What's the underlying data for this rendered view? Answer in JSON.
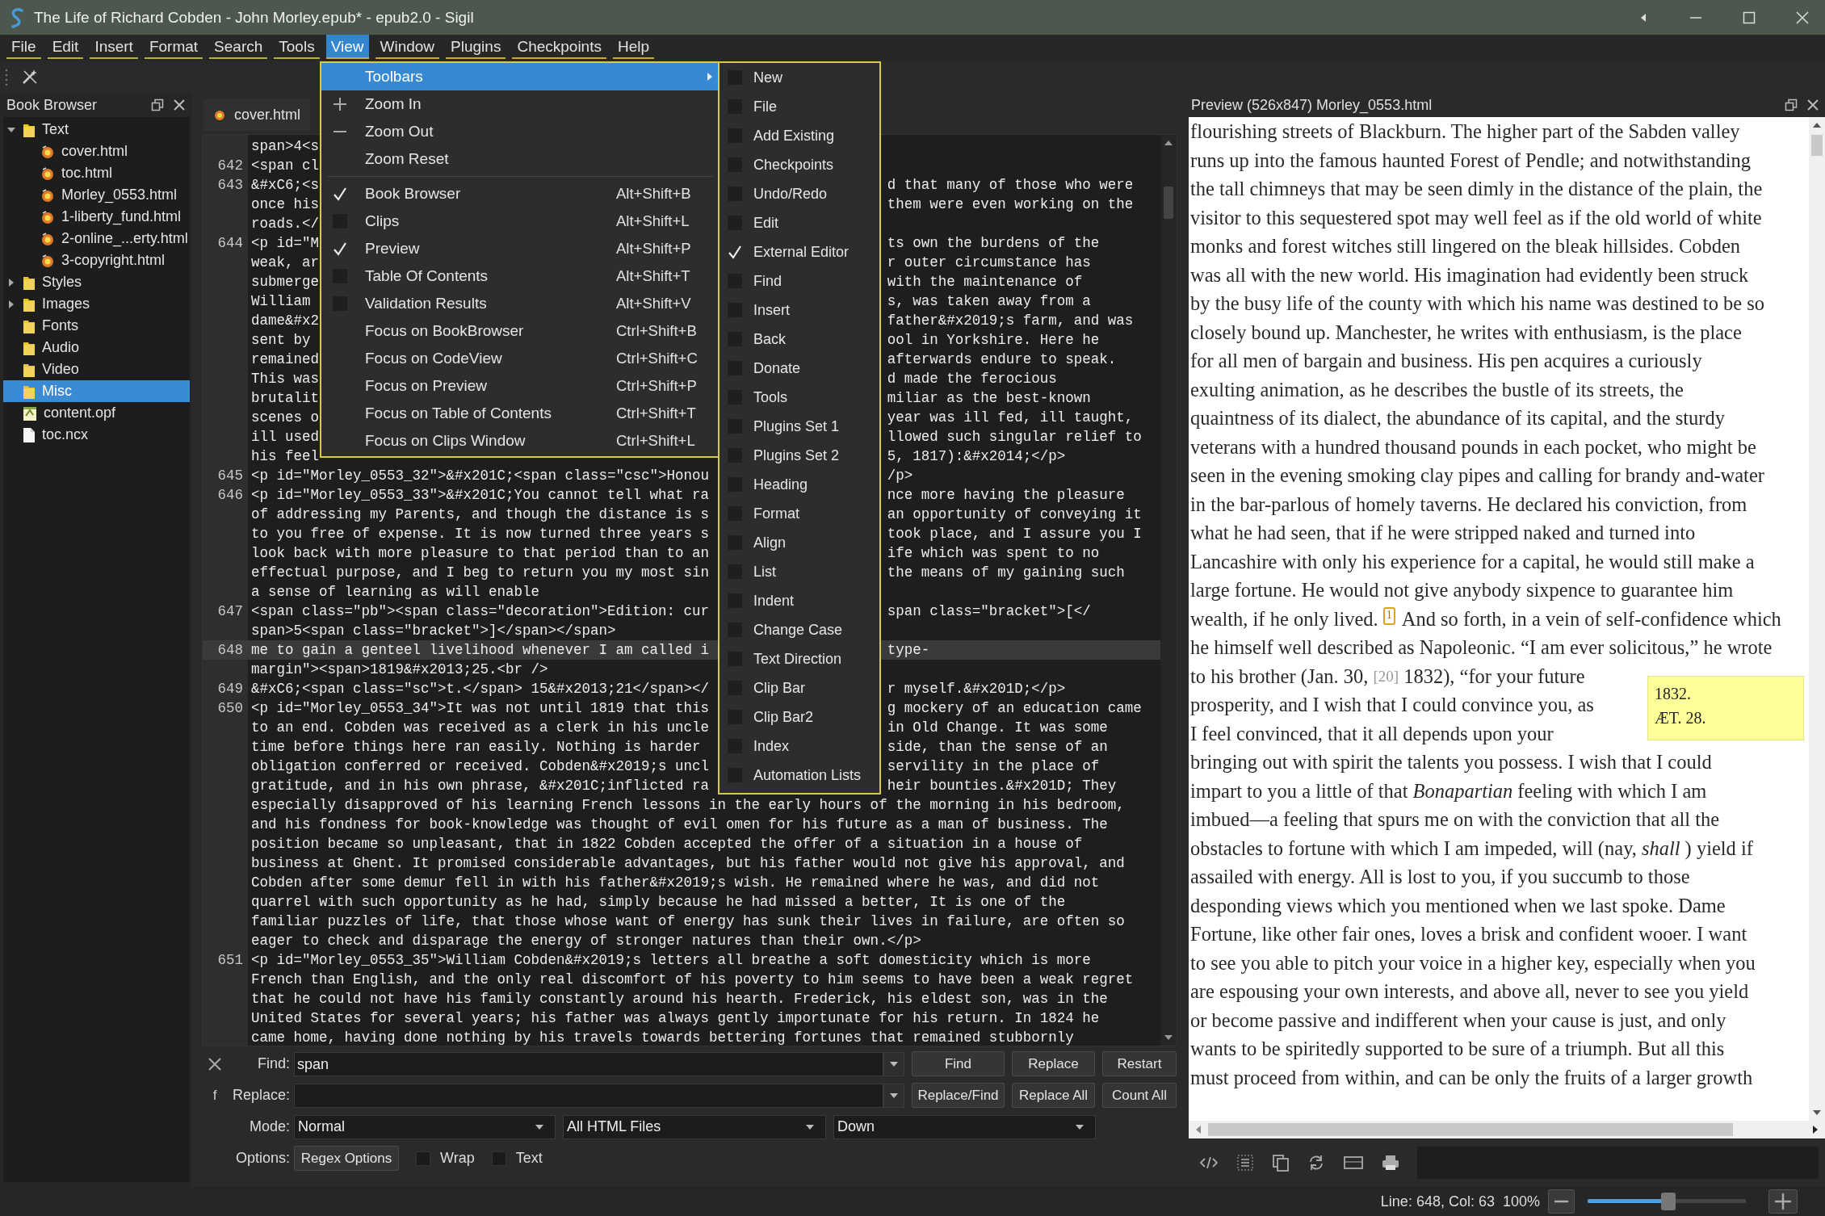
{
  "window": {
    "title": "The Life of Richard Cobden - John Morley.epub* - epub2.0 - Sigil"
  },
  "menu_bar": [
    {
      "label": "File",
      "selected": false
    },
    {
      "label": "Edit",
      "selected": false
    },
    {
      "label": "Insert",
      "selected": false
    },
    {
      "label": "Format",
      "selected": false
    },
    {
      "label": "Search",
      "selected": false
    },
    {
      "label": "Tools",
      "selected": false
    },
    {
      "label": "View",
      "selected": true
    },
    {
      "label": "Window",
      "selected": false
    },
    {
      "label": "Plugins",
      "selected": false
    },
    {
      "label": "Checkpoints",
      "selected": false
    },
    {
      "label": "Help",
      "selected": false
    }
  ],
  "view_menu": {
    "items": [
      {
        "kind": "submenu",
        "label": "Toolbars",
        "selected": true
      },
      {
        "kind": "zoom-in",
        "label": "Zoom In",
        "selected": false
      },
      {
        "kind": "zoom-out",
        "label": "Zoom Out",
        "selected": false
      },
      {
        "kind": "plain",
        "label": "Zoom Reset",
        "selected": false
      },
      {
        "kind": "separator"
      },
      {
        "kind": "check",
        "label": "Book Browser",
        "shortcut": "Alt+Shift+B",
        "checked": true,
        "selected": false
      },
      {
        "kind": "check",
        "label": "Clips",
        "shortcut": "Alt+Shift+L",
        "checked": false,
        "selected": false
      },
      {
        "kind": "check",
        "label": "Preview",
        "shortcut": "Alt+Shift+P",
        "checked": true,
        "selected": false
      },
      {
        "kind": "check",
        "label": "Table Of Contents",
        "shortcut": "Alt+Shift+T",
        "checked": false,
        "selected": false
      },
      {
        "kind": "check",
        "label": "Validation Results",
        "shortcut": "Alt+Shift+V",
        "checked": false,
        "selected": false
      },
      {
        "kind": "plain",
        "label": "Focus on BookBrowser",
        "shortcut": "Ctrl+Shift+B",
        "selected": false
      },
      {
        "kind": "plain",
        "label": "Focus on CodeView",
        "shortcut": "Ctrl+Shift+C",
        "selected": false
      },
      {
        "kind": "plain",
        "label": "Focus on Preview",
        "shortcut": "Ctrl+Shift+P",
        "selected": false
      },
      {
        "kind": "plain",
        "label": "Focus on Table of Contents",
        "shortcut": "Ctrl+Shift+T",
        "selected": false
      },
      {
        "kind": "plain",
        "label": "Focus on Clips Window",
        "shortcut": "Ctrl+Shift+L",
        "selected": false
      }
    ]
  },
  "toolbars_submenu": {
    "items": [
      {
        "label": "New",
        "checked": false
      },
      {
        "label": "File",
        "checked": false
      },
      {
        "label": "Add Existing",
        "checked": false
      },
      {
        "label": "Checkpoints",
        "checked": false
      },
      {
        "label": "Undo/Redo",
        "checked": false
      },
      {
        "label": "Edit",
        "checked": false
      },
      {
        "label": "External Editor",
        "checked": true
      },
      {
        "label": "Find",
        "checked": false
      },
      {
        "label": "Insert",
        "checked": false
      },
      {
        "label": "Back",
        "checked": false
      },
      {
        "label": "Donate",
        "checked": false
      },
      {
        "label": "Tools",
        "checked": false
      },
      {
        "label": "Plugins Set 1",
        "checked": false
      },
      {
        "label": "Plugins Set 2",
        "checked": false
      },
      {
        "label": "Heading",
        "checked": false
      },
      {
        "label": "Format",
        "checked": false
      },
      {
        "label": "Align",
        "checked": false
      },
      {
        "label": "List",
        "checked": false
      },
      {
        "label": "Indent",
        "checked": false
      },
      {
        "label": "Change Case",
        "checked": false
      },
      {
        "label": "Text Direction",
        "checked": false
      },
      {
        "label": "Clip Bar",
        "checked": false
      },
      {
        "label": "Clip Bar2",
        "checked": false
      },
      {
        "label": "Index",
        "checked": false
      },
      {
        "label": "Automation Lists",
        "checked": false
      }
    ]
  },
  "book_browser": {
    "title": "Book Browser",
    "tree": [
      {
        "label": "Text",
        "kind": "folder",
        "expanded": true,
        "selected": false,
        "children": [
          {
            "label": "cover.html",
            "kind": "html",
            "selected": false
          },
          {
            "label": "toc.html",
            "kind": "html",
            "selected": false
          },
          {
            "label": "Morley_0553.html",
            "kind": "html",
            "selected": false
          },
          {
            "label": "1-liberty_fund.html",
            "kind": "html",
            "selected": false
          },
          {
            "label": "2-online_...erty.html",
            "kind": "html",
            "selected": false
          },
          {
            "label": "3-copyright.html",
            "kind": "html",
            "selected": false
          }
        ]
      },
      {
        "label": "Styles",
        "kind": "folder",
        "expanded": false,
        "selected": false
      },
      {
        "label": "Images",
        "kind": "folder",
        "expanded": false,
        "selected": false
      },
      {
        "label": "Fonts",
        "kind": "folder",
        "selected": false
      },
      {
        "label": "Audio",
        "kind": "folder",
        "selected": false
      },
      {
        "label": "Video",
        "kind": "folder",
        "selected": false
      },
      {
        "label": "Misc",
        "kind": "folder",
        "selected": true
      },
      {
        "label": "content.opf",
        "kind": "opf",
        "selected": false
      },
      {
        "label": "toc.ncx",
        "kind": "file",
        "selected": false
      }
    ]
  },
  "editor": {
    "tabs": [
      {
        "label": "cover.html",
        "selected": true
      }
    ],
    "lines": [
      {
        "left": "span>4<s",
        "current": false
      },
      {
        "num": "642",
        "left": "<span cl",
        "current": false
      },
      {
        "num": "643",
        "left": "&#xC6;<s",
        "right": "d that many of those who were",
        "current": false
      },
      {
        "left": "once his",
        "right": "them were even working on the",
        "current": false
      },
      {
        "left": "roads.</",
        "current": false
      },
      {
        "num": "644",
        "left": "<p id=\"M",
        "right": "ts own the burdens of the",
        "current": false
      },
      {
        "left": "weak, ar",
        "right": "r outer circumstance has",
        "current": false
      },
      {
        "left": "submerge",
        "right": "with the maintenance of",
        "current": false
      },
      {
        "left": "William",
        "right": "s, was taken away from a",
        "current": false
      },
      {
        "left": "dame&#x2",
        "right": "father&#x2019;s farm, and was",
        "current": false
      },
      {
        "left": "sent by",
        "right": "ool in Yorkshire. Here he",
        "current": false
      },
      {
        "left": "remained",
        "right": "afterwards endure to speak.",
        "current": false
      },
      {
        "left": "This was",
        "right": "d made the ferocious",
        "current": false
      },
      {
        "left": "brutalit",
        "right": "miliar as the best-known",
        "current": false
      },
      {
        "left": "scenes o",
        "right": "year was ill fed, ill taught,",
        "current": false
      },
      {
        "left": "ill used",
        "right": "llowed such singular relief to",
        "current": false
      },
      {
        "left": "his feel",
        "right": "5, 1817):&#x2014;</p>",
        "current": false
      },
      {
        "num": "645",
        "left": "<p id=\"Morley_0553_32\">&#x201C;<span class=\"csc\">Honou",
        "right": "/p>",
        "current": false
      },
      {
        "num": "646",
        "left": "<p id=\"Morley_0553_33\">&#x201C;You cannot tell what ra",
        "right": "nce more having the pleasure",
        "current": false
      },
      {
        "left": "of addressing my Parents, and though the distance is s",
        "right": "an opportunity of conveying it",
        "current": false
      },
      {
        "left": "to you free of expense. It is now turned three years s",
        "right": "took place, and I assure you I",
        "current": false
      },
      {
        "left": "look back with more pleasure to that period than to an",
        "right": "ife which was spent to no",
        "current": false
      },
      {
        "left": "effectual purpose, and I beg to return you my most sin",
        "right": "the means of my gaining such",
        "current": false
      },
      {
        "left": "a sense of learning as will enable",
        "current": false
      },
      {
        "num": "647",
        "left": "<span class=\"pb\"><span class=\"decoration\">Edition: cur",
        "right": "span class=\"bracket\">[</",
        "current": false
      },
      {
        "left": "span>5<span class=\"bracket\">]</span></span>",
        "current": false
      },
      {
        "num": "648",
        "left": "me to gain a genteel livelihood whenever I am called i",
        "right": "type-",
        "current": true
      },
      {
        "left": "margin\"><span>1819&#x2013;25.<br />",
        "current": false
      },
      {
        "num": "649",
        "left": "&#xC6;<span class=\"sc\">t.</span> 15&#x2013;21</span></",
        "right": "r myself.&#x201D;</p>",
        "current": false
      },
      {
        "num": "650",
        "left": "<p id=\"Morley_0553_34\">It was not until 1819 that this",
        "right": "g mockery of an education came",
        "current": false
      },
      {
        "left": "to an end. Cobden was received as a clerk in his uncle",
        "right": "in Old Change. It was some",
        "current": false
      },
      {
        "left": "time before things here ran easily. Nothing is harder",
        "right": "side, than the sense of an",
        "current": false
      },
      {
        "left": "obligation conferred or received. Cobden&#x2019;s uncl",
        "right": "servility in the place of",
        "current": false
      },
      {
        "left": "gratitude, and in his own phrase, &#x201C;inflicted ra",
        "right": "heir bounties.&#x201D; They",
        "current": false
      },
      {
        "text": "especially disapproved of his learning French lessons in the early hours of the morning in his bedroom,",
        "current": false
      },
      {
        "text": "and his fondness for book-knowledge was thought of evil omen for his future as a man of business. The",
        "current": false
      },
      {
        "text": "position became so unpleasant, that in 1822 Cobden accepted the offer of a situation in a house of",
        "current": false
      },
      {
        "text": "business at Ghent. It promised considerable advantages, but his father would not give his approval, and",
        "current": false
      },
      {
        "text": "Cobden after some demur fell in with his father&#x2019;s wish. He remained where he was, and did not",
        "current": false
      },
      {
        "text": "quarrel with such opportunity as he had, simply because he had missed a better, It is one of the",
        "current": false
      },
      {
        "text": "familiar puzzles of life, that those whose want of energy has sunk their lives in failure, are often so",
        "current": false
      },
      {
        "text": "eager to check and disparage the energy of stronger natures than their own.</p>",
        "current": false
      },
      {
        "num": "651",
        "text": "<p id=\"Morley_0553_35\">William Cobden&#x2019;s letters all breathe a soft domesticity which is more",
        "current": false
      },
      {
        "text": "French than English, and the only real discomfort of his poverty to him seems to have been a weak regret",
        "current": false
      },
      {
        "text": "that he could not have his family constantly around his hearth. Frederick, his eldest son, was in the",
        "current": false
      },
      {
        "text": "United States for several years; his father was always gently importunate for his return. In 1824 he",
        "current": false
      },
      {
        "text": "came home, having done nothing by his travels towards bettering fortunes that remained stubbornly",
        "current": false
      }
    ]
  },
  "find_bar": {
    "side_text": "f",
    "find_label": "Find:",
    "find_value": "span",
    "replace_label": "Replace:",
    "mode_label": "Mode:",
    "options_label": "Options:",
    "buttons": [
      [
        "Find",
        "Replace",
        "Restart"
      ],
      [
        "Replace/Find",
        "Replace All",
        "Count All"
      ]
    ],
    "dropdowns": [
      "Normal",
      "All HTML Files",
      "Down"
    ],
    "regex_button": "Regex Options",
    "checkboxes": [
      {
        "label": "Wrap",
        "checked": false
      },
      {
        "label": "Text",
        "checked": false
      }
    ]
  },
  "preview": {
    "title": "Preview (526x847) Morley_0553.html",
    "lines": [
      "flourishing streets of Blackburn. The higher part of the Sabden valley",
      "runs up into the famous haunted Forest of Pendle; and notwithstanding",
      "the tall chimneys that may be seen dimly in the distance of the plain, the",
      "visitor to this sequestered spot may well feel as if the old world of white",
      "monks and forest witches still lingered on the bleak hillsides. Cobden",
      "was all with the new world. His imagination had evidently been struck",
      "by the busy life of the county with which his name was destined to be so",
      "closely bound up. Manchester, he writes with enthusiasm, is the place",
      "for all men of bargain and business. His pen acquires a curiously",
      "exulting animation, as he describes the bustle of its streets, the",
      "quaintness of its dialect, the abundance of its capital, and the sturdy",
      "veterans with a hundred thousand pounds in each pocket, who might be",
      "seen in the evening smoking clay pipes and calling for brandy and-water",
      "in the bar-parlous of homely taverns. He declared his conviction, from",
      "what he had seen, that if he were stripped naked and turned into",
      "Lancashire with only his experience for a capital, he would still make a",
      "large fortune. He would not give anybody sixpence to guarantee him",
      {
        "parts": [
          {
            "kind": "text",
            "text": "wealth, if he only lived."
          },
          {
            "kind": "noteref",
            "text": "1"
          },
          {
            "kind": "text",
            "text": "And so forth, in a vein of self-confidence which"
          }
        ]
      },
      "he himself well described as Napoleonic. “I am ever solicitous,” he wrote",
      {
        "parts": [
          {
            "kind": "text",
            "text": "to his brother (Jan. 30,"
          },
          {
            "kind": "pagenum",
            "text": "[20]"
          },
          {
            "kind": "text",
            "text": "1832), “for your future"
          }
        ]
      },
      "prosperity, and I wish that I could convince you, as",
      "I feel convinced, that it all depends upon your",
      "bringing out with spirit the talents you possess. I wish that I could",
      "impart to you a little of that *Bonapartian* feeling with which I am",
      "imbued—a feeling that spurs me on with the conviction that all the",
      "obstacles to fortune with which I am impeded, will (nay, *shall*) yield if",
      "assailed with energy. All is lost to you, if you succumb to those",
      "desponding views which you mentioned when we last spoke. Dame",
      "Fortune, like other fair ones, loves a brisk and confident wooer. I want",
      "to see you able to pitch your voice in a higher key, especially when you",
      "are espousing your own interests, and above all, never to see you yield",
      "or become passive and indifferent when your cause is just, and only",
      "wants to be spiritedly supported to be sure of a triumph. But all this",
      "must proceed from within, and can be only the fruits of a larger growth"
    ],
    "sidenote": [
      "1832.",
      "ÆT. 28."
    ]
  },
  "status_bar": {
    "position": "Line: 648, Col: 63",
    "zoom": "100%",
    "zoom_slider": {
      "level": 0.51
    }
  }
}
